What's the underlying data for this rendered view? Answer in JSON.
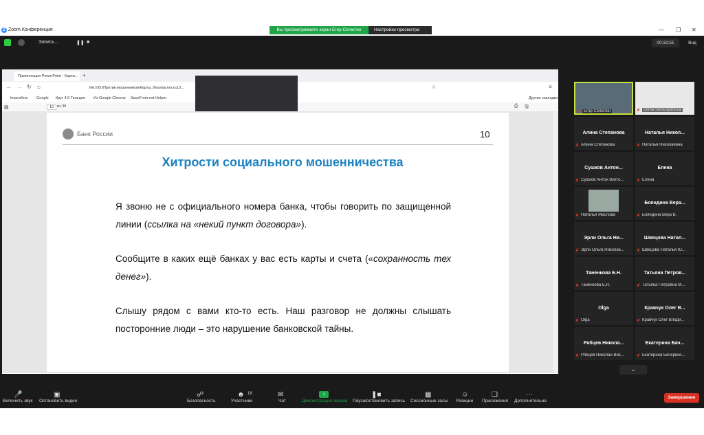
{
  "window": {
    "app_title": "Zoom Конференция",
    "share_banner": "Вы просматриваете экран Егор Селютин",
    "view_settings": "Настройки просмотра",
    "recording": "Запись...",
    "timer": "00:32:51",
    "view": "Вид"
  },
  "browser": {
    "tab_title": "Презентация PowerPoint - Карты...",
    "url": "file:///D:/Против мошенников/Карты_безопасность13...",
    "bookmarks": [
      "krasrollers",
      "Google",
      "Круг 4.5 Тельцея",
      "Из Google Chrome",
      "SaveFrom.net Helper"
    ],
    "other_bookmarks": "Другие закладки",
    "page_current": "10",
    "page_total": "из 39"
  },
  "slide": {
    "bank_name": "Банк России",
    "number": "10",
    "title": "Хитрости социального мошенничества",
    "p1_a": "Я звоню не с официального номера банка, чтобы говорить по защищенной линии (",
    "p1_i": "ссылка на «некий пункт договора»",
    "p1_b": ").",
    "p2_a": "Сообщите в каких ещё банках у вас есть карты и счета («",
    "p2_i": "сохранность тех денег»",
    "p2_b": ").",
    "p3": "Слышу рядом с вами кто-то есть. Наш разговор не должны слышать посторонние люди – это нарушение банковской тайны."
  },
  "participants": [
    {
      "name": "",
      "label": "Егор Селютин"
    },
    {
      "name": "",
      "label": "Elena Sevastyanova"
    },
    {
      "name": "Алина Степанова",
      "label": "Алина Степанова"
    },
    {
      "name": "Наталья Никол...",
      "label": "Наталья Николаевна"
    },
    {
      "name": "Сушков Антон...",
      "label": "Сушков Антон Викто..."
    },
    {
      "name": "Елена",
      "label": "Елена"
    },
    {
      "name": "",
      "label": "Наталья Маслова"
    },
    {
      "name": "Бояндина Вера...",
      "label": "Бояндина Вера В."
    },
    {
      "name": "Эрли Ольга Ни...",
      "label": "Эрли Ольга Николае..."
    },
    {
      "name": "Швецова Натал...",
      "label": "Швецова Наталья Ю..."
    },
    {
      "name": "Таненкова Е.Н.",
      "label": "Таненкова Е.Н."
    },
    {
      "name": "Татьяна Петров...",
      "label": "Татьяна Петровна М..."
    },
    {
      "name": "Olga",
      "label": "Olga"
    },
    {
      "name": "Кравчук Олег В...",
      "label": "Кравчук Олег Влади..."
    },
    {
      "name": "Рябцев Никола...",
      "label": "Рябцев Николай Вик..."
    },
    {
      "name": "Екатерина Бач...",
      "label": "Екатерина Бачерико..."
    }
  ],
  "toolbar": {
    "mute": "Включить звук",
    "video": "Остановить видео",
    "security": "Безопасность",
    "participants": "Участники",
    "participants_count": "18",
    "chat": "Чат",
    "share": "Демонстрация экрана",
    "record": "Пауза/остановить запись",
    "breakout": "Сессионные залы",
    "reactions": "Реакции",
    "apps": "Приложения",
    "more": "Дополнительно",
    "end": "Завершение"
  }
}
